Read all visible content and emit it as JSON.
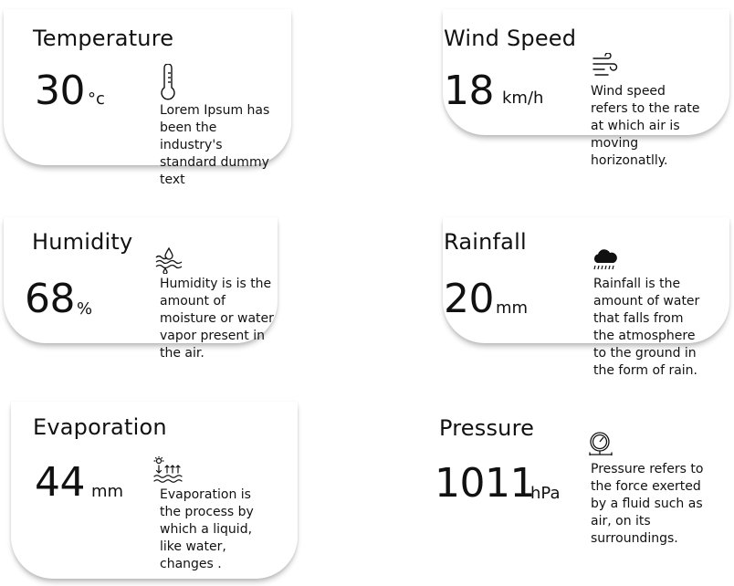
{
  "cards": [
    {
      "title": "Temperature",
      "value": "30",
      "unit": "°c",
      "icon": "thermometer-icon",
      "description": "Lorem Ipsum has\nbeen the\nindustry's\nstandard dummy\ntext"
    },
    {
      "title": "Wind Speed",
      "value": "18",
      "unit": "km/h",
      "icon": "wind-icon",
      "description": "Wind speed\nrefers to  the rate\nat which air is\nmoving\nhorizonatlly."
    },
    {
      "title": "Humidity",
      "value": "68",
      "unit": "%",
      "icon": "humidity-icon",
      "description": "Humidity is is the\namount of\nmoisture or water\nvapor present  in\nthe air."
    },
    {
      "title": "Rainfall",
      "value": "20",
      "unit": "mm",
      "icon": "rain-cloud-icon",
      "description": "Rainfall is the\namount of water\nthat falls from\nthe atmosphere\nto the ground in\nthe form of rain."
    },
    {
      "title": "Evaporation",
      "value": "44",
      "unit": "mm",
      "icon": "evaporation-icon",
      "description": "Evaporation is\nthe process by\nwhich a liquid,\nlike water,\nchanges ."
    },
    {
      "title": "Pressure",
      "value": "1011",
      "unit": "hPa",
      "icon": "pressure-gauge-icon",
      "description": "Pressure refers to\nthe force exerted\nby a fluid such as\nair, on its\nsurroundings."
    }
  ]
}
